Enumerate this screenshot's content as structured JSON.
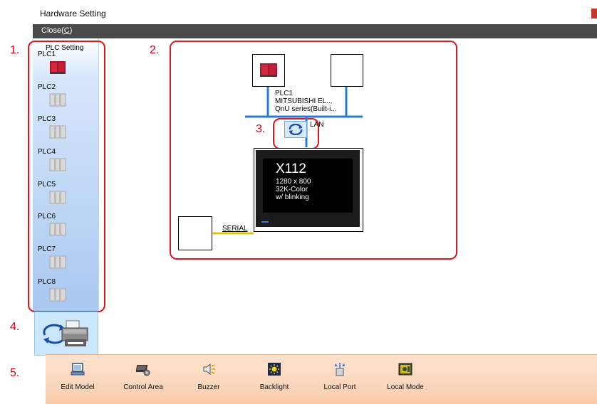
{
  "window": {
    "title": "Hardware Setting"
  },
  "menu": {
    "close_label": "Close(",
    "close_key": "C",
    "close_suffix": ")"
  },
  "annotations": [
    "1.",
    "2.",
    "3.",
    "4.",
    "5."
  ],
  "plc_panel": {
    "heading": "PLC Setting",
    "items": [
      {
        "label": "PLC1",
        "icon": "plc-red-icon"
      },
      {
        "label": "PLC2",
        "icon": "plc-empty-icon"
      },
      {
        "label": "PLC3",
        "icon": "plc-empty-icon"
      },
      {
        "label": "PLC4",
        "icon": "plc-empty-icon"
      },
      {
        "label": "PLC5",
        "icon": "plc-empty-icon"
      },
      {
        "label": "PLC6",
        "icon": "plc-empty-icon"
      },
      {
        "label": "PLC7",
        "icon": "plc-empty-icon"
      },
      {
        "label": "PLC8",
        "icon": "plc-empty-icon"
      }
    ]
  },
  "diagram": {
    "plc1_lines": [
      "PLC1",
      "MITSUBISHI EL...",
      "QnU series(Built-i..."
    ],
    "lan_label": "LAN",
    "serial_label": "SERIAL",
    "hmi": {
      "model": "X112",
      "specs": [
        "1280 x 800",
        "32K-Color",
        "w/ blinking"
      ]
    }
  },
  "toolbar": {
    "items": [
      {
        "label": "Edit Model",
        "icon": "monitor-icon"
      },
      {
        "label": "Control Area",
        "icon": "control-area-icon"
      },
      {
        "label": "Buzzer",
        "icon": "buzzer-icon"
      },
      {
        "label": "Backlight",
        "icon": "backlight-icon"
      },
      {
        "label": "Local Port",
        "icon": "local-port-icon"
      },
      {
        "label": "Local Mode",
        "icon": "local-mode-icon"
      }
    ]
  },
  "colors": {
    "annotation": "#d0021b",
    "lan_line": "#2f78d2",
    "serial_line": "#e7d21a",
    "plc_red": "#c21f3a",
    "toolbar_bg": "#fbd7bd",
    "panel_bg": "#a9c8f0"
  }
}
